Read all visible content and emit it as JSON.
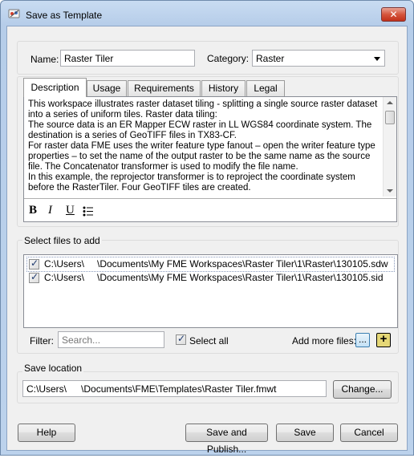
{
  "window": {
    "title": "Save as Template",
    "close_glyph": "✕"
  },
  "name_field": {
    "label": "Name:",
    "value": "Raster Tiler"
  },
  "category_field": {
    "label": "Category:",
    "value": "Raster"
  },
  "tabs": [
    {
      "label": "Description",
      "active": true
    },
    {
      "label": "Usage",
      "active": false
    },
    {
      "label": "Requirements",
      "active": false
    },
    {
      "label": "History",
      "active": false
    },
    {
      "label": "Legal",
      "active": false
    }
  ],
  "description": {
    "lines": [
      "This workspace illustrates raster dataset tiling - splitting a single source raster dataset",
      "into a series of uniform tiles. Raster data tiling:",
      "The source data is an ER Mapper ECW raster in LL WGS84 coordinate system. The",
      "destination is a series of GeoTIFF files in TX83-CF.",
      "For raster data FME uses the writer feature type fanout – open the writer feature type",
      "properties – to set the name of the output raster to be the same name as the source",
      "file. The Concatenator transformer is used to modify the file name.",
      "In this example, the reprojector transformer is to reproject the coordinate system",
      "before the RasterTiler. Four GeoTIFF tiles are created."
    ],
    "format_buttons": {
      "bold": "B",
      "italic": "I",
      "underline": "U"
    }
  },
  "files": {
    "group_label": "Select files to add",
    "items": [
      {
        "path_start": "C:\\Users\\",
        "path_end": "\\Documents\\My FME Workspaces\\Raster Tiler\\1\\Raster\\130105.sdw",
        "checked": true
      },
      {
        "path_start": "C:\\Users\\",
        "path_end": "\\Documents\\My FME Workspaces\\Raster Tiler\\1\\Raster\\130105.sid",
        "checked": true
      }
    ],
    "filter_label": "Filter:",
    "filter_placeholder": "Search...",
    "select_all_label": "Select all",
    "add_more_label": "Add more files:",
    "browse_glyph": "...",
    "add_glyph": "+"
  },
  "save_location": {
    "group_label": "Save location",
    "path_start": "C:\\Users\\",
    "path_end": "\\Documents\\FME\\Templates\\Raster Tiler.fmwt",
    "change_label": "Change..."
  },
  "buttons": {
    "help": "Help",
    "save_publish": "Save and Publish...",
    "save": "Save",
    "cancel": "Cancel"
  },
  "colors": {
    "title_bar": "#bcd2ec",
    "close_button": "#c1301a",
    "browse_button_border": "#3c7fb1",
    "add_button_fill": "#e5d776"
  }
}
